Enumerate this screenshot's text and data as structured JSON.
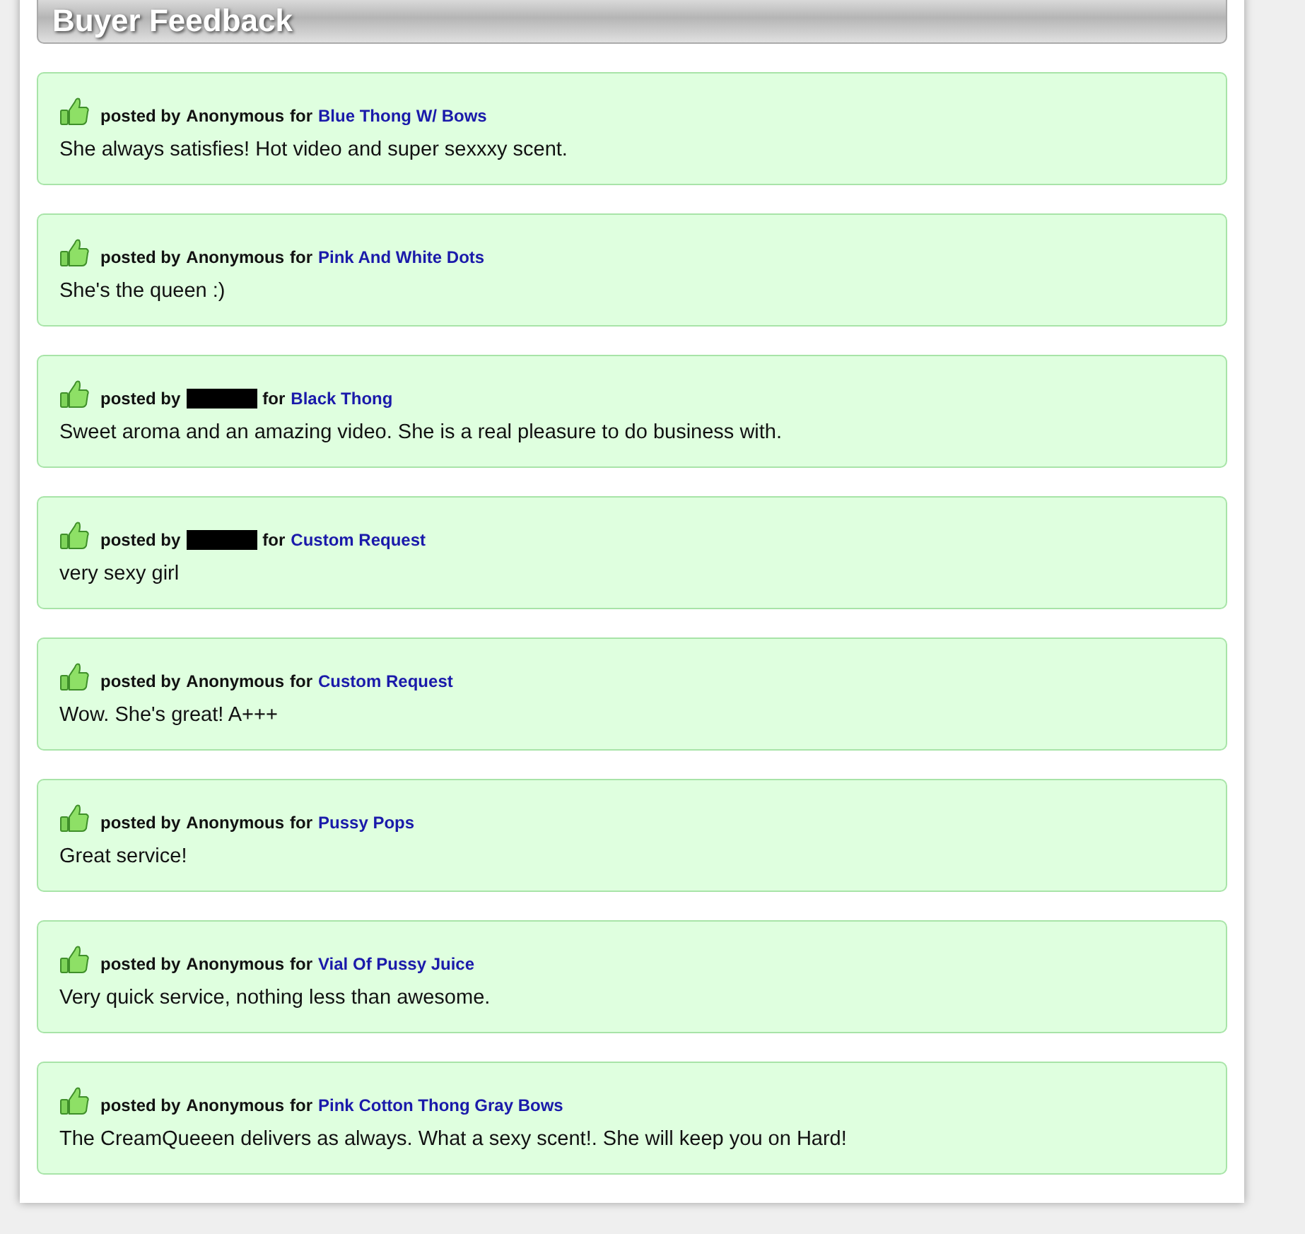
{
  "panel": {
    "title": "Buyer Feedback"
  },
  "feedback": [
    {
      "posted_by_label": "posted by",
      "redacted": false,
      "author": "Anonymous",
      "for_label": "for",
      "product": "Blue Thong W/ Bows",
      "comment": "She always satisfies! Hot video and super sexxxy scent."
    },
    {
      "posted_by_label": "posted by",
      "redacted": false,
      "author": "Anonymous",
      "for_label": "for",
      "product": "Pink And White Dots",
      "comment": "She's the queen :)"
    },
    {
      "posted_by_label": "posted by",
      "redacted": true,
      "for_label": "for",
      "product": "Black Thong",
      "comment": "Sweet aroma and an amazing video. She is a real pleasure to do business with."
    },
    {
      "posted_by_label": "posted by",
      "redacted": true,
      "for_label": "for",
      "product": "Custom Request",
      "comment": "very sexy girl"
    },
    {
      "posted_by_label": "posted by",
      "redacted": false,
      "author": "Anonymous",
      "for_label": "for",
      "product": "Custom Request",
      "comment": "Wow. She's great! A+++"
    },
    {
      "posted_by_label": "posted by",
      "redacted": false,
      "author": "Anonymous",
      "for_label": "for",
      "product": "Pussy Pops",
      "comment": "Great service!"
    },
    {
      "posted_by_label": "posted by",
      "redacted": false,
      "author": "Anonymous",
      "for_label": "for",
      "product": "Vial Of Pussy Juice",
      "comment": "Very quick service, nothing less than awesome."
    },
    {
      "posted_by_label": "posted by",
      "redacted": false,
      "author": "Anonymous",
      "for_label": "for",
      "product": "Pink Cotton Thong Gray Bows",
      "comment": "The CreamQueeen delivers as always. What a sexy scent!. She will keep you on Hard!"
    }
  ]
}
